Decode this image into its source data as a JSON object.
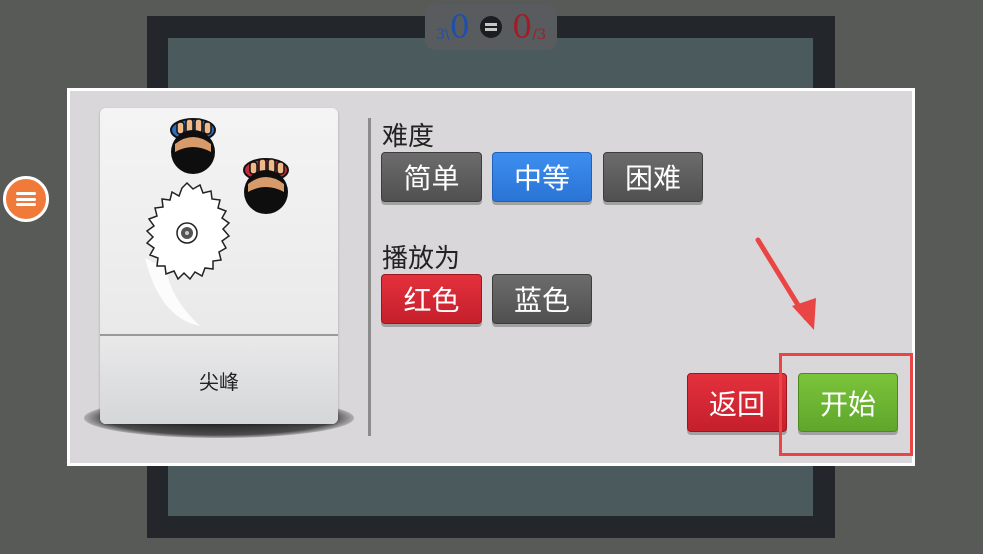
{
  "scoreboard": {
    "blue_target": "3\\",
    "blue_score": "0",
    "red_score": "0",
    "red_target": "/3",
    "colors": {
      "blue": "#1f4fa8",
      "red": "#a51b24"
    }
  },
  "menu": {
    "icon": "hamburger-menu-icon"
  },
  "level": {
    "name": "尖峰"
  },
  "difficulty": {
    "label": "难度",
    "options": [
      "简单",
      "中等",
      "困难"
    ],
    "selected": "中等"
  },
  "play_as": {
    "label": "播放为",
    "options": [
      "红色",
      "蓝色"
    ],
    "selected": "红色"
  },
  "actions": {
    "back_label": "返回",
    "start_label": "开始"
  },
  "annotation": {
    "highlighted": "start-button",
    "color": "#e94545"
  }
}
